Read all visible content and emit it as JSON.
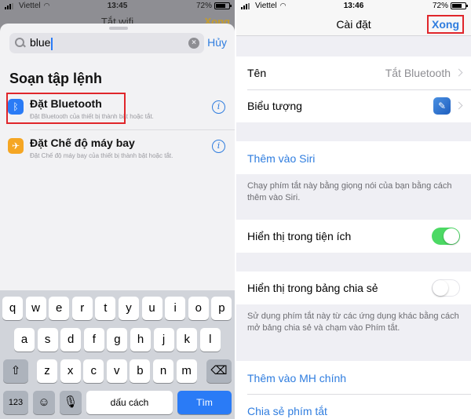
{
  "left": {
    "status": {
      "carrier": "Viettel",
      "time": "13:45",
      "battery": "72%",
      "battery_level": 0.72
    },
    "background_title": "Tắt wifi",
    "background_done": "Xong",
    "search": {
      "query": "blue"
    },
    "cancel_label": "Hủy",
    "section_title": "Soạn tập lệnh",
    "results": [
      {
        "name": "Đặt Bluetooth",
        "subtitle": "Đặt Bluetooth của thiết bị thành bật hoặc tắt.",
        "icon": "bluetooth-icon",
        "color": "#2a7bf6"
      },
      {
        "name": "Đặt Chế độ máy bay",
        "subtitle": "Đặt Chế độ máy bay của thiết bị thành bật hoặc tắt.",
        "icon": "airplane-icon",
        "color": "#f5a623"
      }
    ],
    "keyboard": {
      "row1": [
        "q",
        "w",
        "e",
        "r",
        "t",
        "y",
        "u",
        "i",
        "o",
        "p"
      ],
      "row2": [
        "a",
        "s",
        "d",
        "f",
        "g",
        "h",
        "j",
        "k",
        "l"
      ],
      "row3": [
        "z",
        "x",
        "c",
        "v",
        "b",
        "n",
        "m"
      ],
      "numbers_key": "123",
      "space_key": "dấu cách",
      "go_key": "Tìm"
    }
  },
  "right": {
    "status": {
      "carrier": "Viettel",
      "time": "13:46",
      "battery": "72%",
      "battery_level": 0.72
    },
    "nav": {
      "title": "Cài đặt",
      "done_label": "Xong"
    },
    "name_row": {
      "label": "Tên",
      "value": "Tắt Bluetooth"
    },
    "icon_row": {
      "label": "Biểu tượng"
    },
    "siri_link": "Thêm vào Siri",
    "siri_note": "Chạy phím tắt này bằng giọng nói của bạn bằng cách thêm vào Siri.",
    "widget_row": {
      "label": "Hiển thị trong tiện ích",
      "on": true
    },
    "share_row": {
      "label": "Hiển thị trong bảng chia sẻ",
      "on": false
    },
    "share_note": "Sử dụng phím tắt này từ các ứng dụng khác bằng cách mở bảng chia sẻ và chạm vào Phím tắt.",
    "home_link": "Thêm vào MH chính",
    "share_link": "Chia sẻ phím tắt"
  }
}
